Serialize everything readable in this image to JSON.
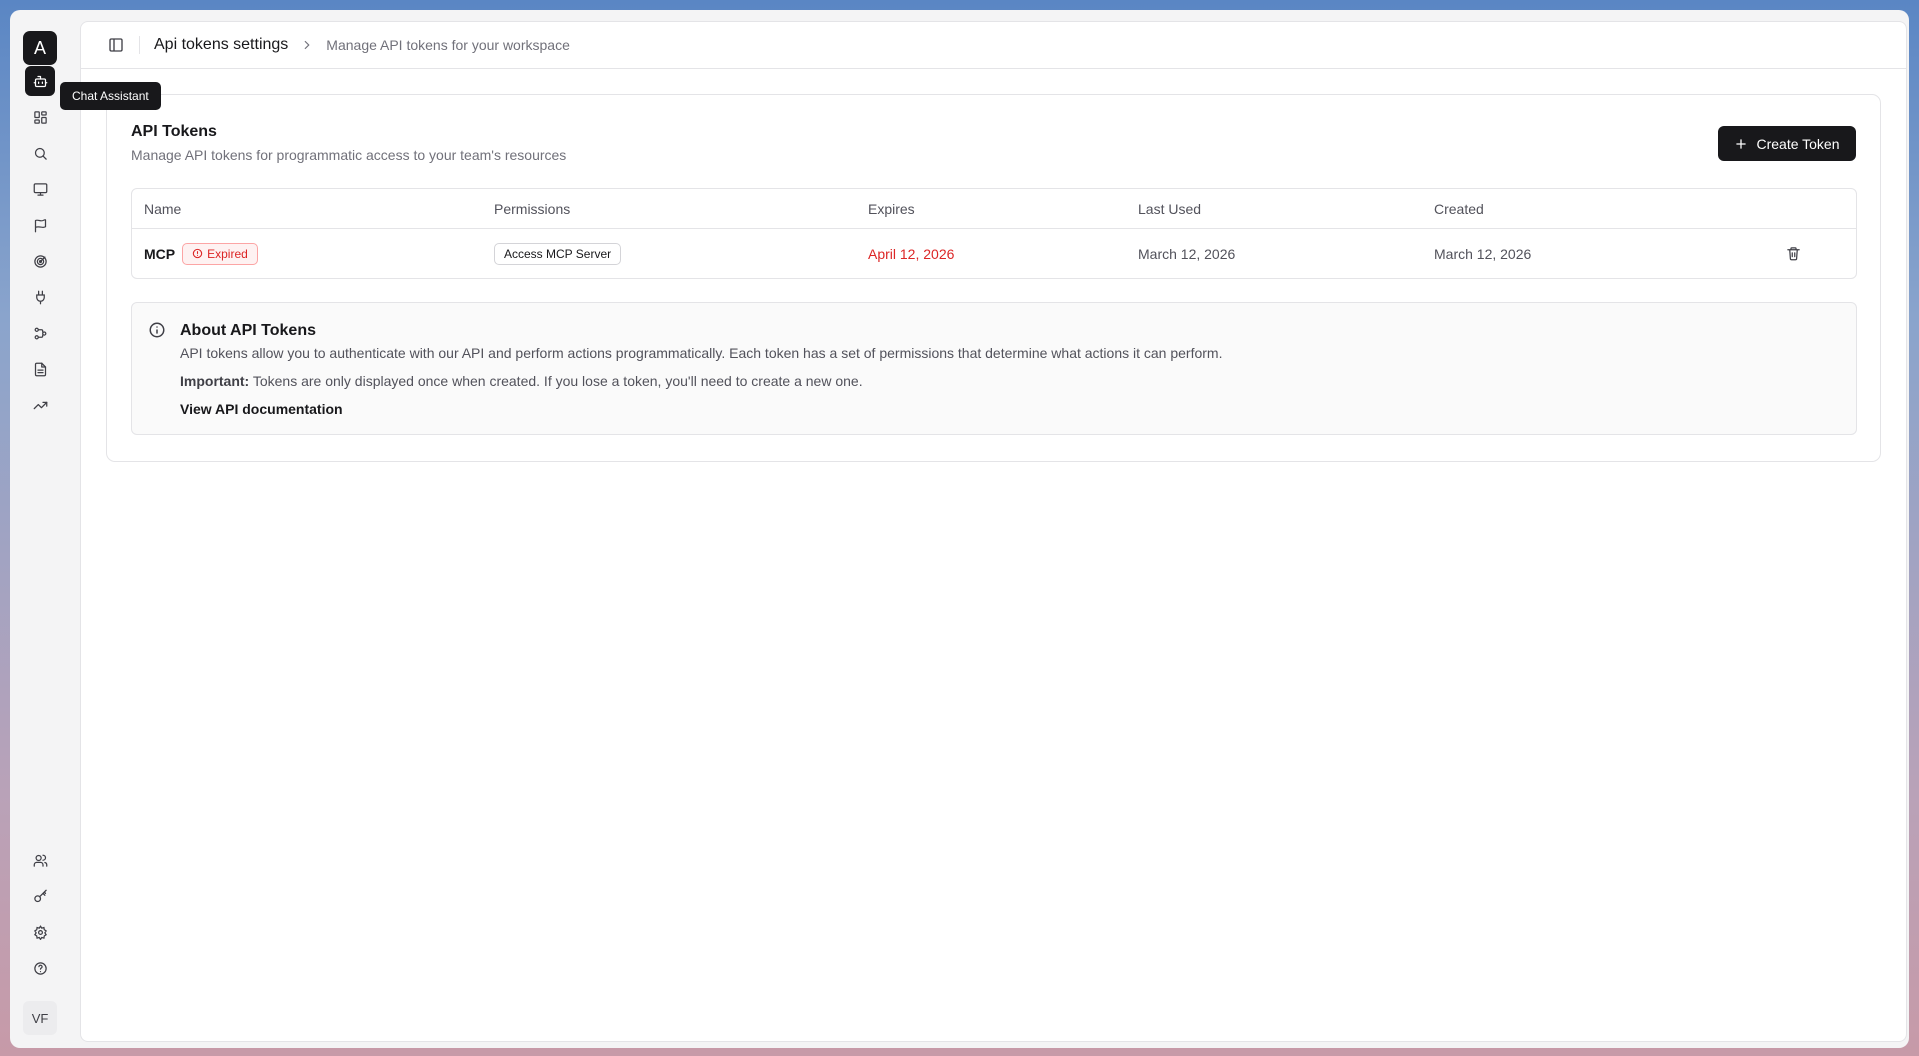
{
  "sidebar": {
    "logo_letter": "A",
    "tooltip": "Chat Assistant",
    "avatar_initials": "VF",
    "nav_icons": [
      "bot-icon",
      "dashboard-icon",
      "search-icon",
      "monitor-icon",
      "flag-icon",
      "radar-icon",
      "plug-icon",
      "workflow-icon",
      "document-icon",
      "trending-up-icon",
      "users-icon",
      "key-icon",
      "settings-icon",
      "help-icon"
    ]
  },
  "header": {
    "title": "Api tokens settings",
    "subtitle": "Manage API tokens for your workspace"
  },
  "tokens_card": {
    "title": "API Tokens",
    "subtitle": "Manage API tokens for programmatic access to your team's resources",
    "create_label": "Create Token"
  },
  "table": {
    "headers": {
      "name": "Name",
      "permissions": "Permissions",
      "expires": "Expires",
      "last_used": "Last Used",
      "created": "Created"
    },
    "rows": [
      {
        "name": "MCP",
        "status": "Expired",
        "permission": "Access MCP Server",
        "expires": "April 12, 2026",
        "last_used": "March 12, 2026",
        "created": "March 12, 2026"
      }
    ]
  },
  "about": {
    "title": "About API Tokens",
    "body": "API tokens allow you to authenticate with our API and perform actions programmatically. Each token has a set of permissions that determine what actions it can perform.",
    "important_label": "Important:",
    "important_text": "Tokens are only displayed once when created. If you lose a token, you'll need to create a new one.",
    "doc_link": "View API documentation"
  },
  "colors": {
    "accent": "#18181b",
    "danger": "#dc2626",
    "muted": "#71717a"
  }
}
